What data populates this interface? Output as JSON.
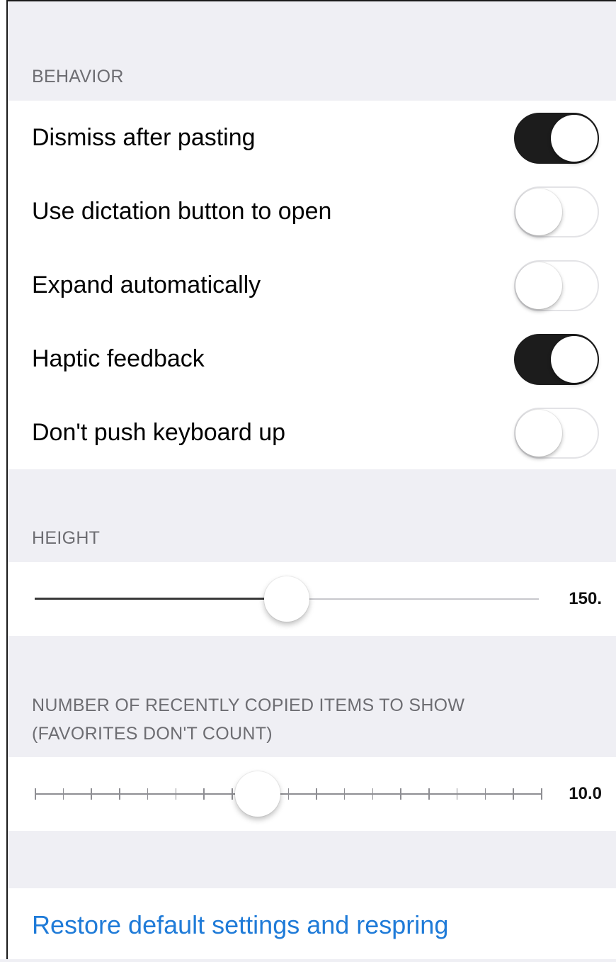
{
  "behavior": {
    "header": "BEHAVIOR",
    "rows": [
      {
        "label": "Dismiss after pasting",
        "state": "on"
      },
      {
        "label": "Use dictation button to open",
        "state": "off"
      },
      {
        "label": "Expand automatically",
        "state": "off"
      },
      {
        "label": "Haptic feedback",
        "state": "on"
      },
      {
        "label": "Don't push keyboard up",
        "state": "off"
      }
    ]
  },
  "height": {
    "header": "HEIGHT",
    "value_label": "150.",
    "fraction": 0.5
  },
  "recent_items": {
    "header_line1": "NUMBER OF RECENTLY COPIED ITEMS TO SHOW",
    "header_line2": "(FAVORITES DON'T COUNT)",
    "value_label": "10.0",
    "fraction": 0.44,
    "tick_count": 19
  },
  "restore": {
    "label": "Restore default settings and respring"
  },
  "colors": {
    "background": "#efeff4",
    "switch_on": "#1c1c1c",
    "link": "#1f7bd8"
  }
}
